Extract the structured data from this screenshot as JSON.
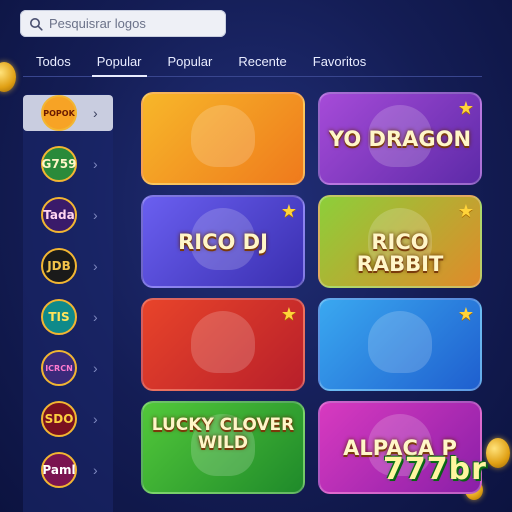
{
  "search": {
    "placeholder": "Pesquisrar logos",
    "icon": "search-icon"
  },
  "tabs": [
    {
      "label": "Todos",
      "active": false
    },
    {
      "label": "Popular",
      "active": true
    },
    {
      "label": "Popular",
      "active": false
    },
    {
      "label": "Recente",
      "active": false
    },
    {
      "label": "Favoritos",
      "active": false
    }
  ],
  "sidebar": {
    "items": [
      {
        "label": "POPOK",
        "bg": "#f7a325",
        "fg": "#6a1a00",
        "active": true
      },
      {
        "label": "G759",
        "bg": "#2a8a3a",
        "fg": "#fff6c8",
        "active": false
      },
      {
        "label": "Tada",
        "bg": "#3a1a6a",
        "fg": "#ffd6f0",
        "active": false
      },
      {
        "label": "JDB",
        "bg": "#1a1a1a",
        "fg": "#f2c34a",
        "active": false
      },
      {
        "label": "TIS",
        "bg": "#0f8a8a",
        "fg": "#ffe45a",
        "active": false
      },
      {
        "label": "ICRCN",
        "bg": "#3a2a7a",
        "fg": "#ff7ad0",
        "active": false
      },
      {
        "label": "SDO",
        "bg": "#7a1020",
        "fg": "#ffd040",
        "active": false
      },
      {
        "label": "Paml",
        "bg": "#7a1450",
        "fg": "#ffffff",
        "active": false
      }
    ]
  },
  "games": [
    {
      "title": "",
      "bg": "linear-gradient(135deg,#f7b72a,#ef7a1c)",
      "favorite": false
    },
    {
      "title": "YO DRAGON",
      "bg": "linear-gradient(135deg,#a64bd8,#5d2aa8)",
      "favorite": true
    },
    {
      "title": "RICO DJ",
      "bg": "linear-gradient(135deg,#6a5ff0,#3a2fb0)",
      "favorite": true
    },
    {
      "title": "RICO RABBIT",
      "bg": "linear-gradient(135deg,#8ccf3a,#e08a2a)",
      "favorite": true
    },
    {
      "title": "",
      "bg": "linear-gradient(135deg,#e8442a,#b81f2a)",
      "favorite": true
    },
    {
      "title": "",
      "bg": "linear-gradient(135deg,#3aa8f0,#1f5fcf)",
      "favorite": true
    },
    {
      "title": "LUCKY CLOVER WILD",
      "bg": "linear-gradient(135deg,#52c83a,#1f8a2a)",
      "favorite": false
    },
    {
      "title": "ALPACA P",
      "bg": "linear-gradient(135deg,#d83ac0,#8a1fa8)",
      "favorite": false
    }
  ],
  "watermark": "777br",
  "colors": {
    "accent": "#e8ecff",
    "star": "#ffd43a"
  }
}
